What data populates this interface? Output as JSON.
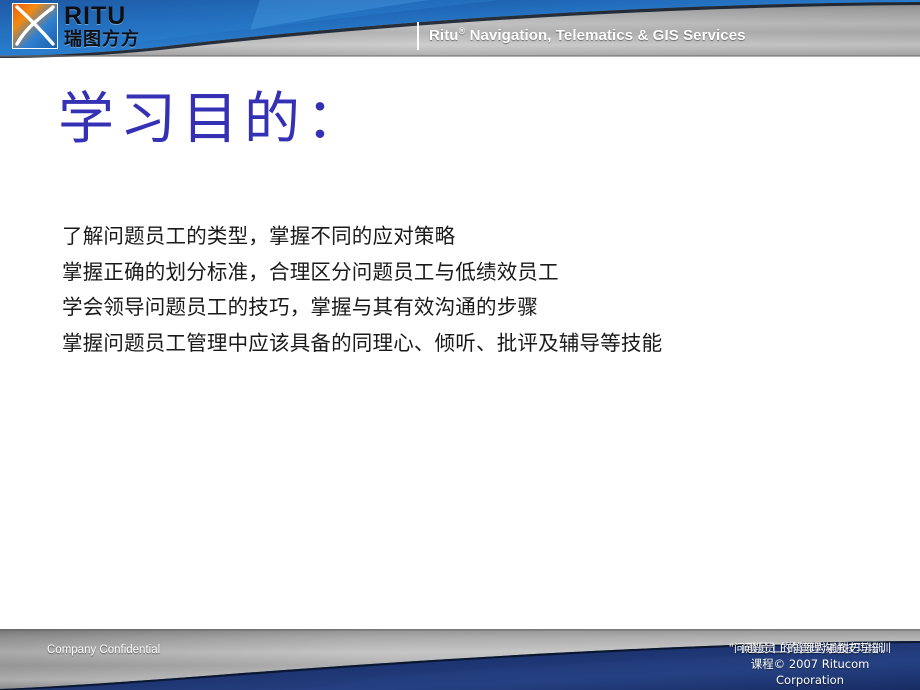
{
  "header": {
    "logo": {
      "mark_name": "ritu-x-logo-mark",
      "latin": "RITU",
      "chinese": "瑞图方方"
    },
    "title_prefix": "Ritu",
    "title_sup": "®",
    "title_rest": " Navigation, Telematics & GIS Services",
    "blue": "#1b62ae",
    "silver": "#9a9a9a"
  },
  "slide": {
    "title": "学习目的：",
    "bullets": [
      "了解问题员工的类型，掌握不同的应对策略",
      "掌握正确的划分标准，合理区分问题员工与低绩效员工",
      "学会领导问题员工的技巧，掌握与其有效沟通的步骤",
      "掌握问题员工管理中应该具备的同理心、倾听、批评及辅导等技能"
    ],
    "title_color": "#3531b4",
    "text_color": "#1a1a1a"
  },
  "footer": {
    "left": "Company Confidential",
    "right_line1_a": "\"问题员工的管理沟通技巧培训",
    "right_line1_b": "问题员工的管理沟通技巧培训",
    "right_line2": "课程© 2007 Ritucom",
    "right_line3": "Corporation",
    "navy": "#1b2f66"
  }
}
